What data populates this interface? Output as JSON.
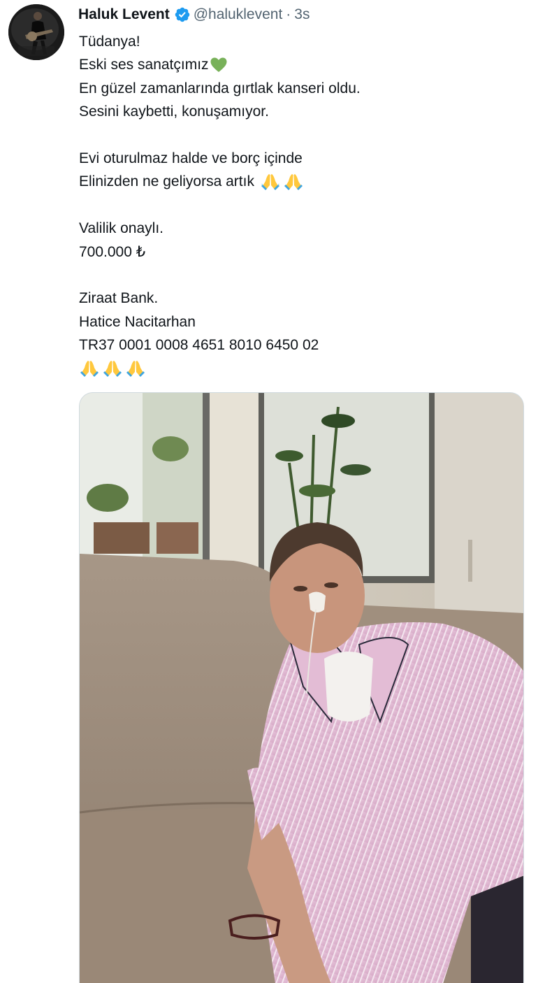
{
  "tweet": {
    "display_name": "Haluk Levent",
    "handle": "@haluklevent",
    "separator": "·",
    "timestamp": "3s",
    "lines": [
      "Tüdanya!",
      "Eski ses sanatçımız",
      "En güzel zamanlarında gırtlak kanseri oldu.",
      "Sesini kaybetti, konuşamıyor.",
      "Evi oturulmaz halde ve borç içinde",
      "Elinizden ne geliyorsa artık",
      "Valilik onaylı.",
      "700.000 ₺",
      "Ziraat Bank.",
      "Hatice Nacitarhan",
      "TR37 0001 0008 4651 8010 6450 02"
    ],
    "icons": {
      "verified": "verified-badge-icon",
      "heart": "green-heart-emoji",
      "pray": "folded-hands-emoji"
    },
    "colors": {
      "verified_blue": "#1d9bf0",
      "heart_green": "#78b159",
      "text": "#0f1419",
      "secondary_text": "#536471"
    }
  }
}
